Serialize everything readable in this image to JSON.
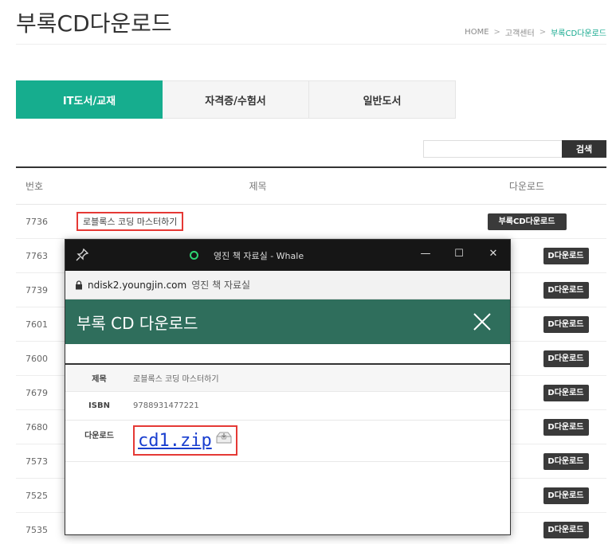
{
  "page": {
    "title": "부록CD다운로드"
  },
  "breadcrumb": {
    "home": "HOME",
    "sep": ">",
    "center": "고객센터",
    "current": "부록CD다운로드"
  },
  "tabs": [
    {
      "label": "IT도서/교재",
      "active": true
    },
    {
      "label": "자격증/수험서",
      "active": false
    },
    {
      "label": "일반도서",
      "active": false
    }
  ],
  "search": {
    "value": "",
    "button_label": "검색"
  },
  "table": {
    "headers": {
      "no": "번호",
      "title": "제목",
      "download": "다운로드"
    },
    "rows": [
      {
        "no": "7736",
        "title": "로블록스 코딩 마스터하기",
        "btn": "부록CD다운로드"
      },
      {
        "no": "7763",
        "btn": "D다운로드"
      },
      {
        "no": "7739",
        "btn": "D다운로드"
      },
      {
        "no": "7601",
        "btn": "D다운로드"
      },
      {
        "no": "7600",
        "btn": "D다운로드"
      },
      {
        "no": "7679",
        "btn": "D다운로드"
      },
      {
        "no": "7680",
        "btn": "D다운로드"
      },
      {
        "no": "7573",
        "btn": "D다운로드"
      },
      {
        "no": "7525",
        "btn": "D다운로드"
      },
      {
        "no": "7535",
        "btn": "D다운로드"
      }
    ]
  },
  "popup": {
    "window_title": "영진 책 자료실 - Whale",
    "address_domain": "ndisk2.youngjin.com",
    "address_site": "영진 책 자료실",
    "header_title": "부록 CD 다운로드",
    "fields": {
      "title_label": "제목",
      "title_value": "로블록스 코딩 마스터하기",
      "isbn_label": "ISBN",
      "isbn_value": "9788931477221",
      "download_label": "다운로드",
      "file_name": "cd1.zip"
    }
  },
  "colors": {
    "accent": "#16ad8e",
    "popup_header": "#2f6e5c",
    "highlight": "#e53935",
    "link": "#1a3fcf"
  }
}
